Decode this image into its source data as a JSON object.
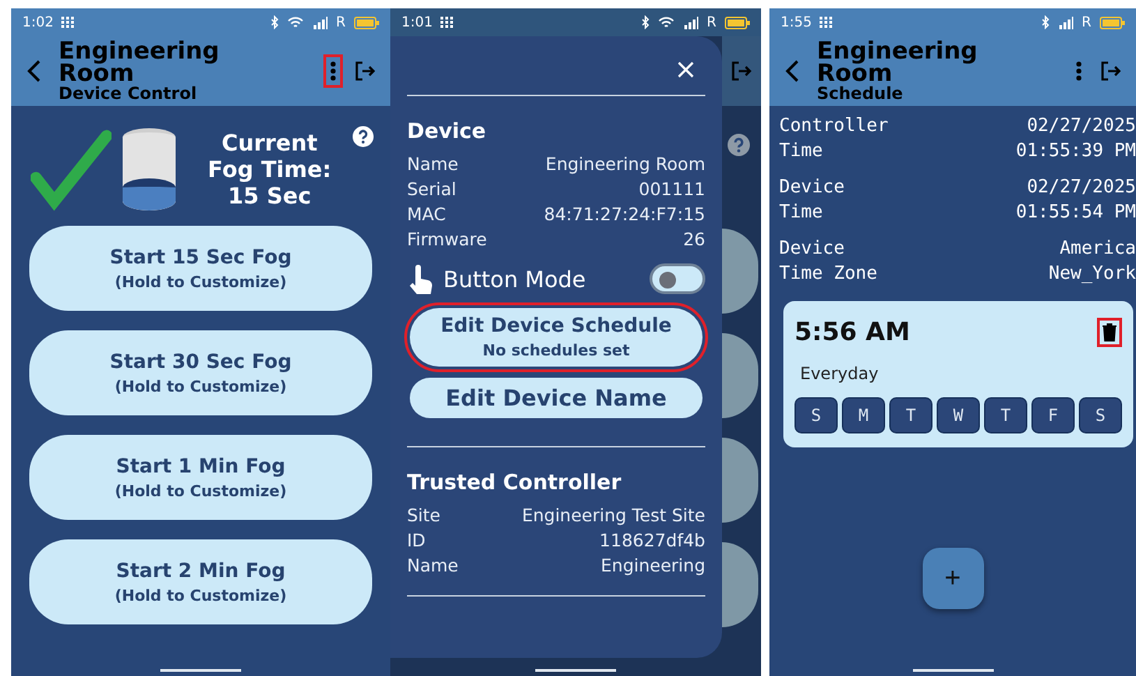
{
  "screens": [
    {
      "kind": "device_control",
      "status_bar": {
        "time": "1:02",
        "network": "R",
        "wifi": true
      },
      "header": {
        "title": "Engineering Room",
        "subtitle": "Device Control",
        "menu_highlighted": true
      },
      "status": {
        "connected": true,
        "level": 0.4,
        "label": "Current Fog Time:",
        "value": "15 Sec"
      },
      "buttons": [
        {
          "label": "Start 15 Sec Fog",
          "hint": "(Hold to Customize)"
        },
        {
          "label": "Start 30 Sec Fog",
          "hint": "(Hold to Customize)"
        },
        {
          "label": "Start 1 Min Fog",
          "hint": "(Hold to Customize)"
        },
        {
          "label": "Start 2 Min Fog",
          "hint": "(Hold to Customize)"
        }
      ]
    },
    {
      "kind": "drawer",
      "status_bar": {
        "time": "1:01",
        "network": "R",
        "wifi": true
      },
      "device": {
        "title": "Device",
        "rows": [
          {
            "label": "Name",
            "value": "Engineering Room"
          },
          {
            "label": "Serial",
            "value": "001111"
          },
          {
            "label": "MAC",
            "value": "84:71:27:24:F7:15"
          },
          {
            "label": "Firmware",
            "value": "26"
          }
        ]
      },
      "button_mode": {
        "label": "Button Mode",
        "on": false
      },
      "schedule_button": {
        "label": "Edit Device Schedule",
        "sub": "No schedules set",
        "highlighted": true
      },
      "name_button": {
        "label": "Edit Device Name"
      },
      "trusted": {
        "title": "Trusted Controller",
        "rows": [
          {
            "label": "Site",
            "value": "Engineering Test Site"
          },
          {
            "label": "ID",
            "value": "118627df4b"
          },
          {
            "label": "Name",
            "value": "Engineering"
          }
        ]
      }
    },
    {
      "kind": "schedule",
      "status_bar": {
        "time": "1:55",
        "network": "R",
        "wifi": false
      },
      "header": {
        "title": "Engineering Room",
        "subtitle": "Schedule"
      },
      "times": [
        {
          "label": [
            "Controller",
            "Time"
          ],
          "value": [
            "02/27/2025",
            "01:55:39 PM"
          ]
        },
        {
          "label": [
            "Device",
            "Time"
          ],
          "value": [
            "02/27/2025",
            "01:55:54 PM"
          ]
        },
        {
          "label": [
            "Device",
            "Time Zone"
          ],
          "value": [
            "America",
            "New_York"
          ]
        }
      ],
      "schedules": [
        {
          "time": "5:56 AM",
          "repeat": "Everyday",
          "delete_highlighted": true,
          "days": [
            {
              "label": "S",
              "selected": true
            },
            {
              "label": "M",
              "selected": true
            },
            {
              "label": "T",
              "selected": true
            },
            {
              "label": "W",
              "selected": true
            },
            {
              "label": "T",
              "selected": true
            },
            {
              "label": "F",
              "selected": true
            },
            {
              "label": "S",
              "selected": true
            }
          ]
        }
      ],
      "fab": "+"
    }
  ]
}
